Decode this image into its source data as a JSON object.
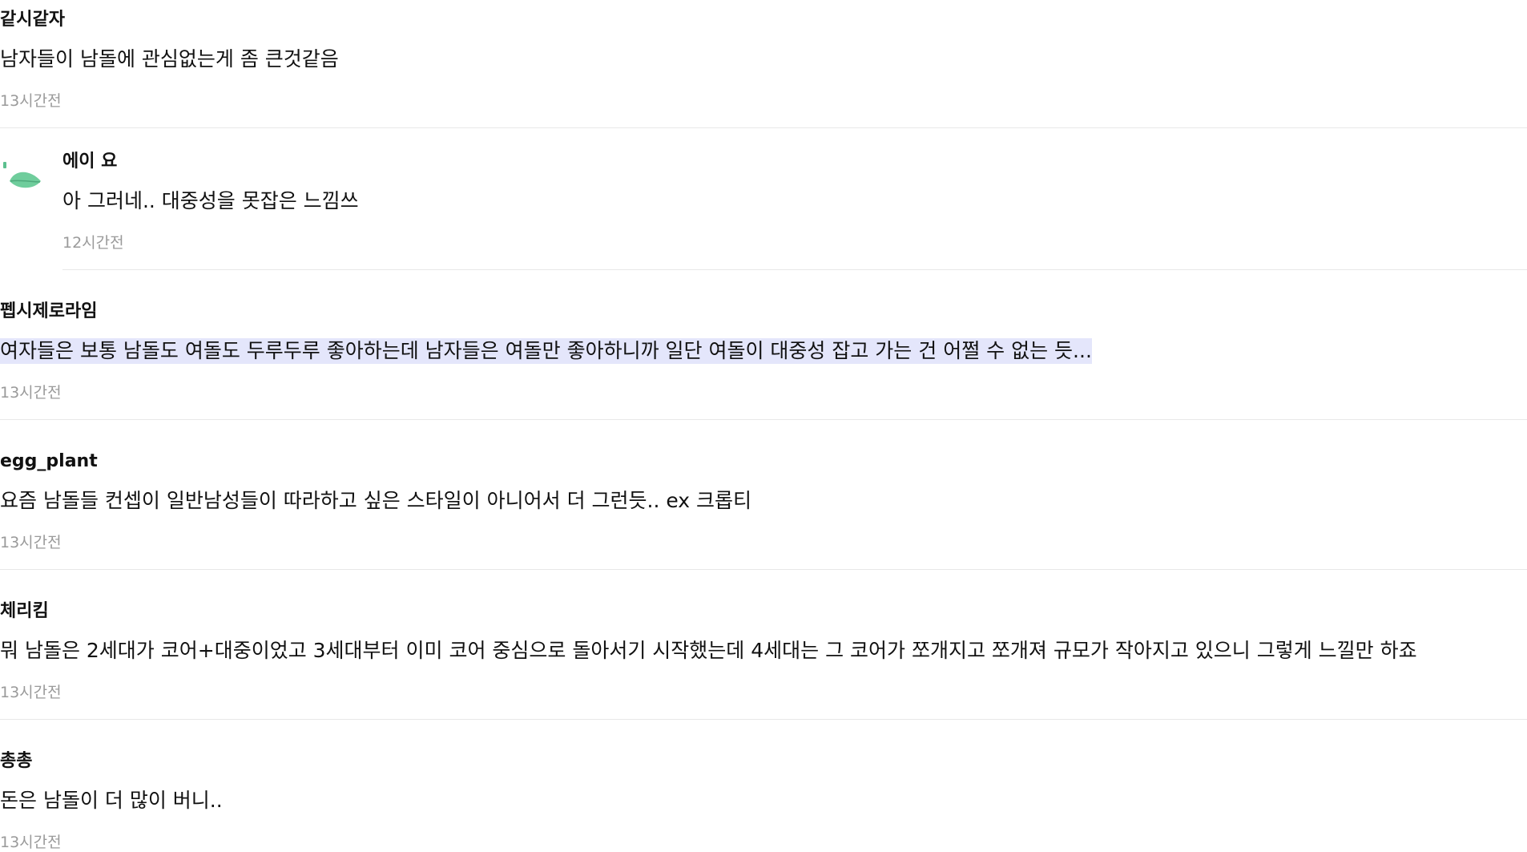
{
  "comments": [
    {
      "author": "같시같자",
      "body": "남자들이 남돌에 관심없는게 좀 큰것같음",
      "time": "13시간전"
    },
    {
      "author": "에이 요",
      "body": "아 그러네.. 대중성을 못잡은 느낌쓰",
      "time": "12시간전",
      "is_reply": true,
      "avatar_icon": "leaf-icon",
      "accent": "#5cc08f"
    },
    {
      "author": "펩시제로라임",
      "body": "여자들은 보통 남돌도 여돌도 두루두루 좋아하는데 남자들은 여돌만 좋아하니까 일단 여돌이 대중성 잡고 가는 건 어쩔 수 없는 듯...",
      "time": "13시간전",
      "selected_text_highlight": "#e4e6fb"
    },
    {
      "author": "egg_plant",
      "body": "요즘 남돌들 컨셉이 일반남성들이 따라하고 싶은 스타일이 아니어서 더 그런듯.. ex 크롭티",
      "time": "13시간전"
    },
    {
      "author": "체리킴",
      "body": "뭐 남돌은 2세대가 코어+대중이었고 3세대부터 이미 코어 중심으로 돌아서기 시작했는데 4세대는 그 코어가 쪼개지고 쪼개져 규모가 작아지고 있으니 그렇게 느낄만 하죠",
      "time": "13시간전"
    },
    {
      "author": "총총",
      "body": "돈은 남돌이 더 많이 버니..",
      "time": "13시간전"
    }
  ]
}
